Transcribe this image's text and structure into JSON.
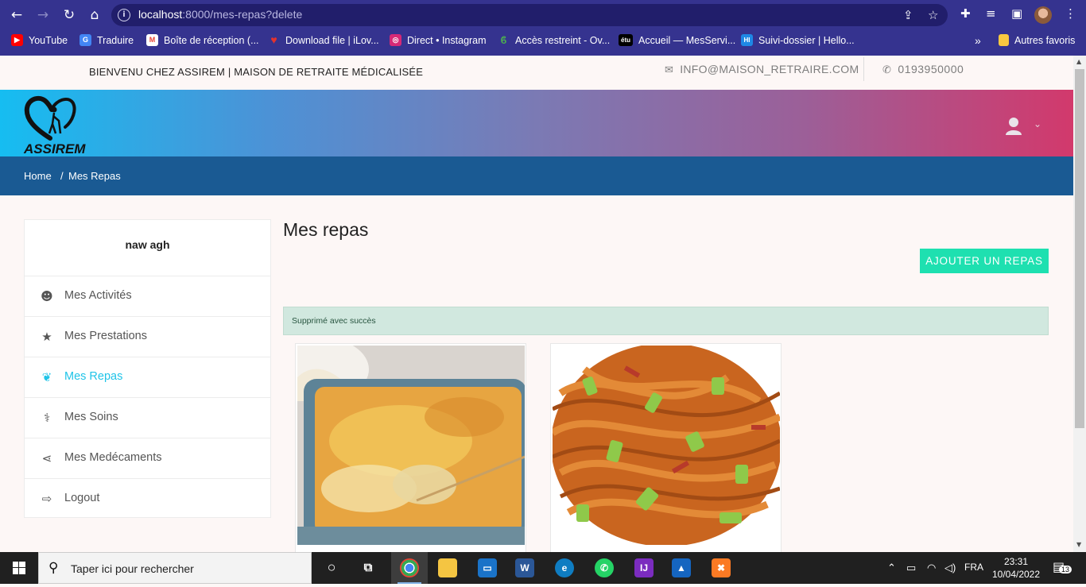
{
  "browser": {
    "url_host": "localhost",
    "url_rest": ":8000/mes-repas?delete",
    "bookmarks": [
      {
        "label": "YouTube",
        "color": "#ff0000",
        "glyph": "▶"
      },
      {
        "label": "Traduire",
        "color": "#4285f4",
        "glyph": "G"
      },
      {
        "label": "Boîte de réception (...",
        "color": "#ea4335",
        "glyph": "M"
      },
      {
        "label": "Download file | iLov...",
        "color": "#e5322d",
        "glyph": "♥"
      },
      {
        "label": "Direct • Instagram",
        "color": "#d62976",
        "glyph": "◎"
      },
      {
        "label": "Accès restreint - Ov...",
        "color": "#2e7d32",
        "glyph": "ϐ"
      },
      {
        "label": "Accueil — MesServi...",
        "color": "#000000",
        "glyph": "étu"
      },
      {
        "label": "Suivi-dossier | Hello...",
        "color": "#1e88e5",
        "glyph": "HI"
      }
    ],
    "bookmarks_more": "»",
    "other_bookmarks": "Autres favoris"
  },
  "site": {
    "welcome": "BIENVENU CHEZ ASSIREM | MAISON DE RETRAITE MÉDICALISÉE",
    "email": "INFO@MAISON_RETRAIRE.COM",
    "phone": "0193950000",
    "logo_text": "ASSIREM",
    "breadcrumb": {
      "home": "Home",
      "sep": "/",
      "current": "Mes Repas"
    }
  },
  "sidebar": {
    "user_name": "naw agh",
    "items": [
      {
        "label": "Mes Activités",
        "icon": "smile-icon",
        "active": false
      },
      {
        "label": "Mes Prestations",
        "icon": "star-icon",
        "active": false
      },
      {
        "label": "Mes Repas",
        "icon": "leaf-icon",
        "active": true
      },
      {
        "label": "Mes Soins",
        "icon": "stethoscope-icon",
        "active": false
      },
      {
        "label": "Mes Medécaments",
        "icon": "share-icon",
        "active": false
      },
      {
        "label": "Logout",
        "icon": "logout-icon",
        "active": false
      }
    ]
  },
  "main": {
    "title": "Mes repas",
    "add_button": "AJOUTER UN REPAS",
    "alert": "Supprimé avec succès",
    "meals": [
      {
        "image": "gratin"
      },
      {
        "image": "noodles"
      }
    ]
  },
  "taskbar": {
    "search_placeholder": "Taper ici pour rechercher",
    "language": "FRA",
    "time": "23:31",
    "date": "10/04/2022",
    "notifications": "13"
  }
}
